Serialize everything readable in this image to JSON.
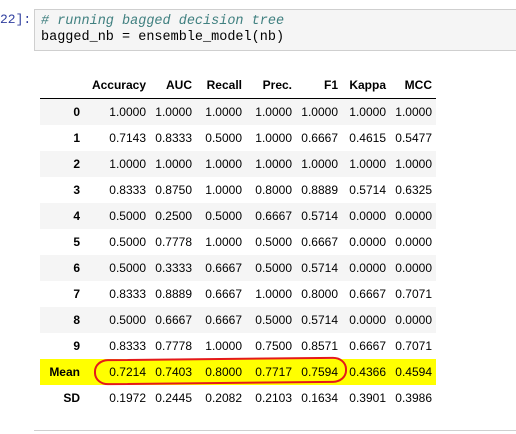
{
  "cell": {
    "prompt": "22]:",
    "comment": "# running bagged decision tree",
    "code": "bagged_nb = ensemble_model(nb)"
  },
  "table": {
    "columns": [
      "",
      "Accuracy",
      "AUC",
      "Recall",
      "Prec.",
      "F1",
      "Kappa",
      "MCC"
    ],
    "rows": [
      {
        "index": "0",
        "values": [
          "1.0000",
          "1.0000",
          "1.0000",
          "1.0000",
          "1.0000",
          "1.0000",
          "1.0000"
        ]
      },
      {
        "index": "1",
        "values": [
          "0.7143",
          "0.8333",
          "0.5000",
          "1.0000",
          "0.6667",
          "0.4615",
          "0.5477"
        ]
      },
      {
        "index": "2",
        "values": [
          "1.0000",
          "1.0000",
          "1.0000",
          "1.0000",
          "1.0000",
          "1.0000",
          "1.0000"
        ]
      },
      {
        "index": "3",
        "values": [
          "0.8333",
          "0.8750",
          "1.0000",
          "0.8000",
          "0.8889",
          "0.5714",
          "0.6325"
        ]
      },
      {
        "index": "4",
        "values": [
          "0.5000",
          "0.2500",
          "0.5000",
          "0.6667",
          "0.5714",
          "0.0000",
          "0.0000"
        ]
      },
      {
        "index": "5",
        "values": [
          "0.5000",
          "0.7778",
          "1.0000",
          "0.5000",
          "0.6667",
          "0.0000",
          "0.0000"
        ]
      },
      {
        "index": "6",
        "values": [
          "0.5000",
          "0.3333",
          "0.6667",
          "0.5000",
          "0.5714",
          "0.0000",
          "0.0000"
        ]
      },
      {
        "index": "7",
        "values": [
          "0.8333",
          "0.8889",
          "0.6667",
          "1.0000",
          "0.8000",
          "0.6667",
          "0.7071"
        ]
      },
      {
        "index": "8",
        "values": [
          "0.5000",
          "0.6667",
          "0.6667",
          "0.5000",
          "0.5714",
          "0.0000",
          "0.0000"
        ]
      },
      {
        "index": "9",
        "values": [
          "0.8333",
          "0.7778",
          "1.0000",
          "0.7500",
          "0.8571",
          "0.6667",
          "0.7071"
        ]
      },
      {
        "index": "Mean",
        "values": [
          "0.7214",
          "0.7403",
          "0.8000",
          "0.7717",
          "0.7594",
          "0.4366",
          "0.4594"
        ]
      },
      {
        "index": "SD",
        "values": [
          "0.1972",
          "0.2445",
          "0.2082",
          "0.2103",
          "0.1634",
          "0.3901",
          "0.3986"
        ]
      }
    ],
    "highlight_row": "Mean",
    "highlight_color": "#ffff00",
    "annotation_color": "#e41a1a"
  }
}
